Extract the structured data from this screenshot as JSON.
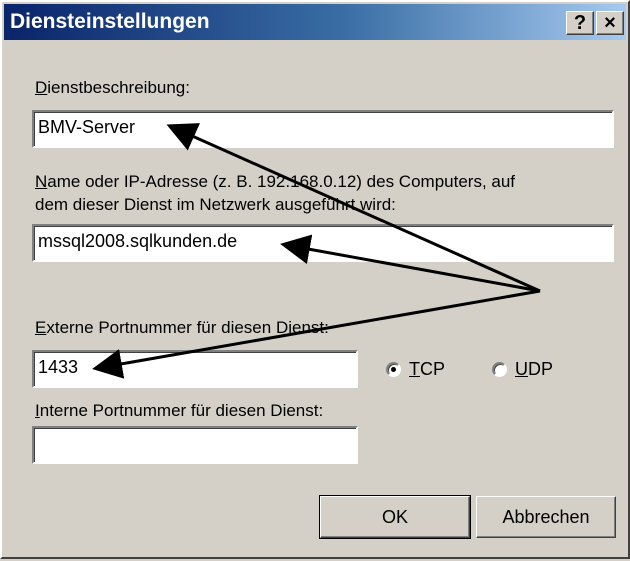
{
  "window": {
    "title": "Diensteinstellungen",
    "help_label": "?",
    "close_label": "×"
  },
  "form": {
    "description_label_access": "D",
    "description_label_rest": "ienstbeschreibung:",
    "description_value": "BMV-Server",
    "host_label_access": "N",
    "host_label_rest_line1": "ame oder IP-Adresse (z. B. 192.168.0.12) des Computers, auf",
    "host_label_line2": "dem dieser Dienst im Netzwerk ausgeführt wird:",
    "host_value": "mssql2008.sqlkunden.de",
    "external_port_label_access": "E",
    "external_port_label_rest": "xterne Portnummer für diesen Dienst:",
    "external_port_value": "1433",
    "protocol": {
      "tcp_access": "T",
      "tcp_rest": "CP",
      "udp_access": "U",
      "udp_rest": "DP",
      "selected": "TCP"
    },
    "internal_port_label_access": "I",
    "internal_port_label_rest": "nterne Portnummer für diesen Dienst:",
    "internal_port_value": ""
  },
  "buttons": {
    "ok": "OK",
    "cancel": "Abbrechen"
  }
}
